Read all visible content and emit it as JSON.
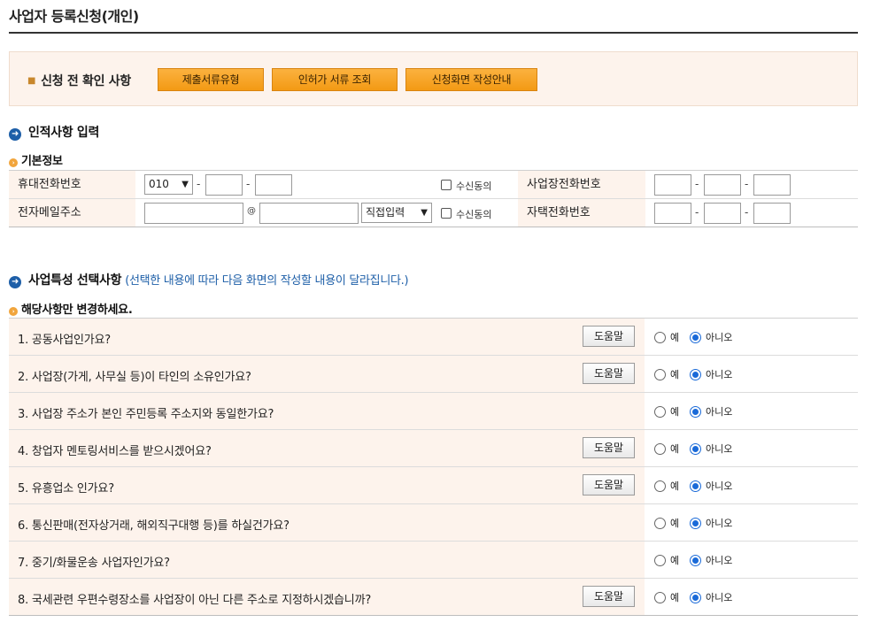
{
  "page": {
    "title": "사업자 등록신청(개인)"
  },
  "notice": {
    "label": "신청 전 확인 사항",
    "buttons": [
      "제출서류유형",
      "인허가 서류 조회",
      "신청화면 작성안내"
    ]
  },
  "identity": {
    "section_title": "인적사항 입력",
    "sub_title": "기본정보",
    "mobile_label": "휴대전화번호",
    "mobile_prefix": "010",
    "dash": "-",
    "consent_label": "수신동의",
    "business_phone_label": "사업장전화번호",
    "email_label": "전자메일주소",
    "at_sign": "@",
    "email_domain_select": "직접입력",
    "home_phone_label": "자택전화번호"
  },
  "business": {
    "section_title": "사업특성 선택사항",
    "section_note": "(선택한 내용에 따라 다음 화면의 작성할 내용이 달라집니다.)",
    "sub_title": "해당사항만 변경하세요.",
    "help_label": "도움말",
    "yes_label": "예",
    "no_label": "아니오",
    "questions": [
      {
        "text": "1. 공동사업인가요?",
        "has_help": true,
        "answer": "no"
      },
      {
        "text": "2. 사업장(가게, 사무실 등)이 타인의 소유인가요?",
        "has_help": true,
        "answer": "no"
      },
      {
        "text": "3. 사업장 주소가 본인 주민등록 주소지와 동일한가요?",
        "has_help": false,
        "answer": "no"
      },
      {
        "text": "4. 창업자 멘토링서비스를 받으시겠어요?",
        "has_help": true,
        "answer": "no"
      },
      {
        "text": "5. 유흥업소 인가요?",
        "has_help": true,
        "answer": "no"
      },
      {
        "text": "6. 통신판매(전자상거래, 해외직구대행 등)를 하실건가요?",
        "has_help": false,
        "answer": "no"
      },
      {
        "text": "7. 중기/화물운송 사업자인가요?",
        "has_help": false,
        "answer": "no"
      },
      {
        "text": "8. 국세관련 우편수령장소를 사업장이 아닌 다른 주소로 지정하시겠습니까?",
        "has_help": true,
        "answer": "no"
      }
    ]
  },
  "icons": {
    "section_icon": "arrow-circle-icon",
    "sub_icon": "small-arrow-circle-icon",
    "dropdown_icon": "chevron-down-icon"
  },
  "colors": {
    "accent_orange": "#f39a14",
    "accent_blue": "#1e5fa8",
    "header_bg": "#fdf3ec"
  }
}
